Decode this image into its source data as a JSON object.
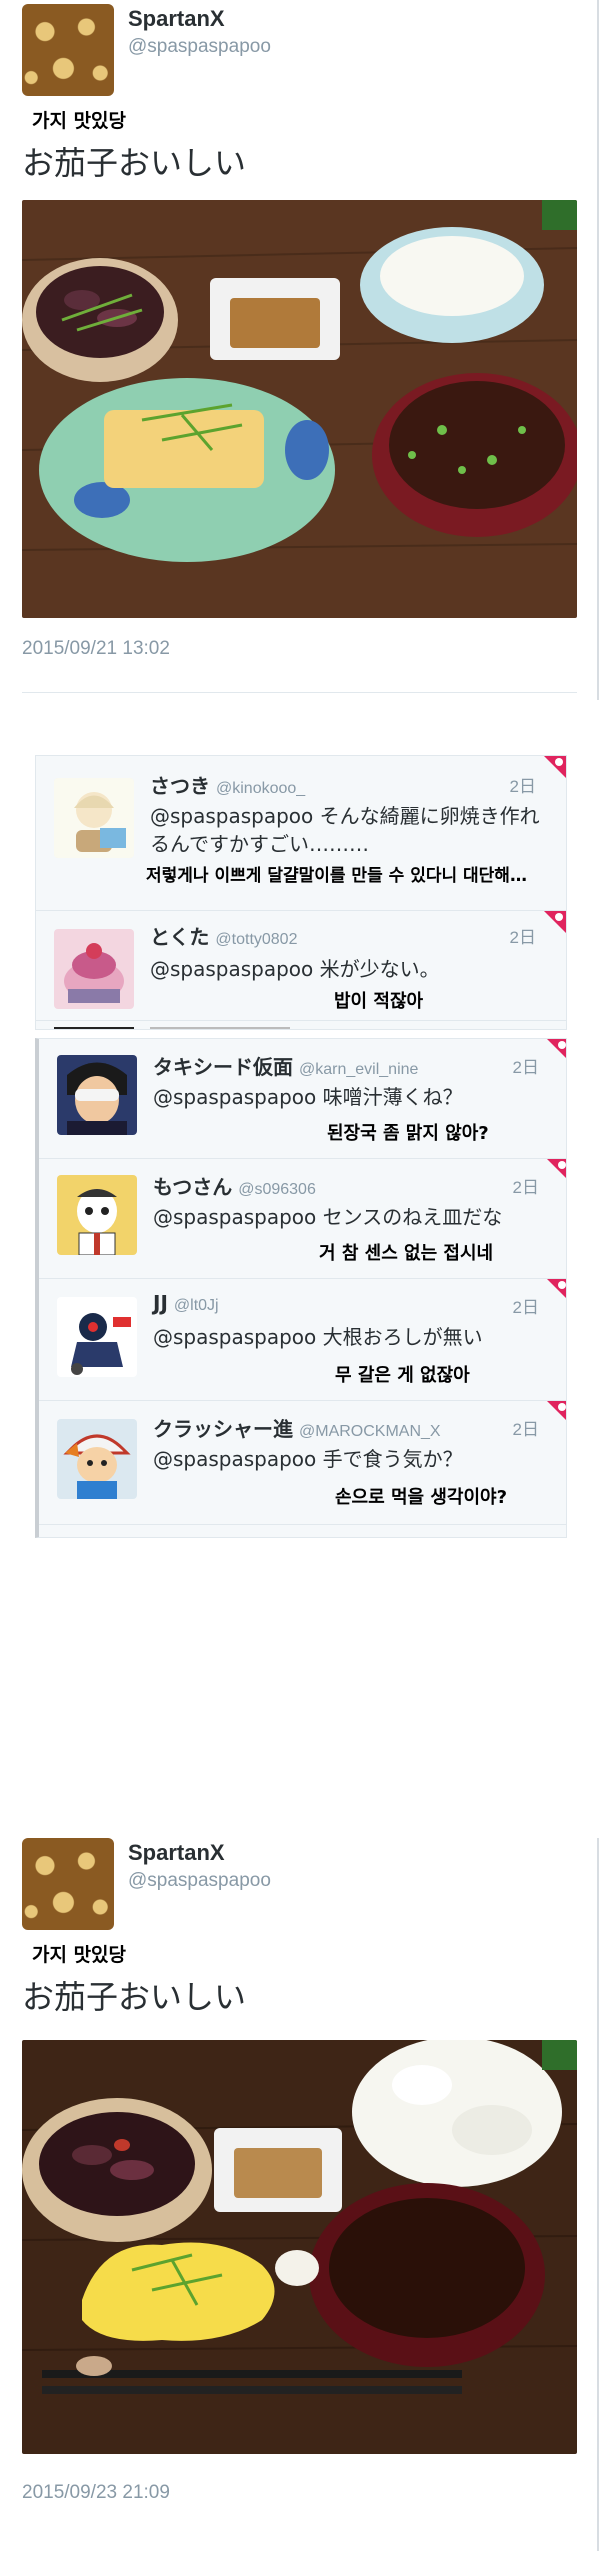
{
  "tweet1": {
    "name": "SpartanX",
    "handle": "@spaspaspapoo",
    "ko_note": "가지 맛있당",
    "text": "お茄子おいしい",
    "date": "2015/09/21 13:02"
  },
  "replies": [
    {
      "name": "さつき",
      "handle": "@kinokooo_",
      "time": "2日",
      "text": "@spaspaspapoo そんな綺麗に卵焼き作れるんですかすごい………",
      "ko": "저렇게나 이쁘게 달걀말이를 만들 수 있다니 대단해…"
    },
    {
      "name": "とくた",
      "handle": "@totty0802",
      "time": "2日",
      "text": "@spaspaspapoo 米が少ない。",
      "ko": "밥이 적잖아"
    },
    {
      "name": "タキシード仮面",
      "handle": "@karn_evil_nine",
      "time": "2日",
      "text": "@spaspaspapoo 味噌汁薄くね？",
      "ko": "된장국 좀 맑지 않아?"
    },
    {
      "name": "もつさん",
      "handle": "@s096306",
      "time": "2日",
      "text": "@spaspaspapoo センスのねえ皿だな",
      "ko": "거 참 센스 없는 접시네"
    },
    {
      "name": "JJ",
      "handle": "@lt0Jj",
      "time": "2日",
      "text": "@spaspaspapoo 大根おろしが無い",
      "ko": "무 갈은 게 없잖아"
    },
    {
      "name": "クラッシャー進",
      "handle": "@MAROCKMAN_X",
      "time": "2日",
      "text": "@spaspaspapoo 手で食う気か？",
      "ko": "손으로 먹을 생각이야?"
    }
  ],
  "tweet2": {
    "name": "SpartanX",
    "handle": "@spaspaspapoo",
    "ko_note": "가지 맛있당",
    "text": "お茄子おいしい",
    "date": "2015/09/23 21:09"
  },
  "colors": {
    "accent_heart": "#e0245e",
    "meta_gray": "#8899a6",
    "table_wood": "#4a2e1c"
  },
  "icons": [
    "giraffe-pattern-avatar",
    "heart-tab-icon"
  ]
}
